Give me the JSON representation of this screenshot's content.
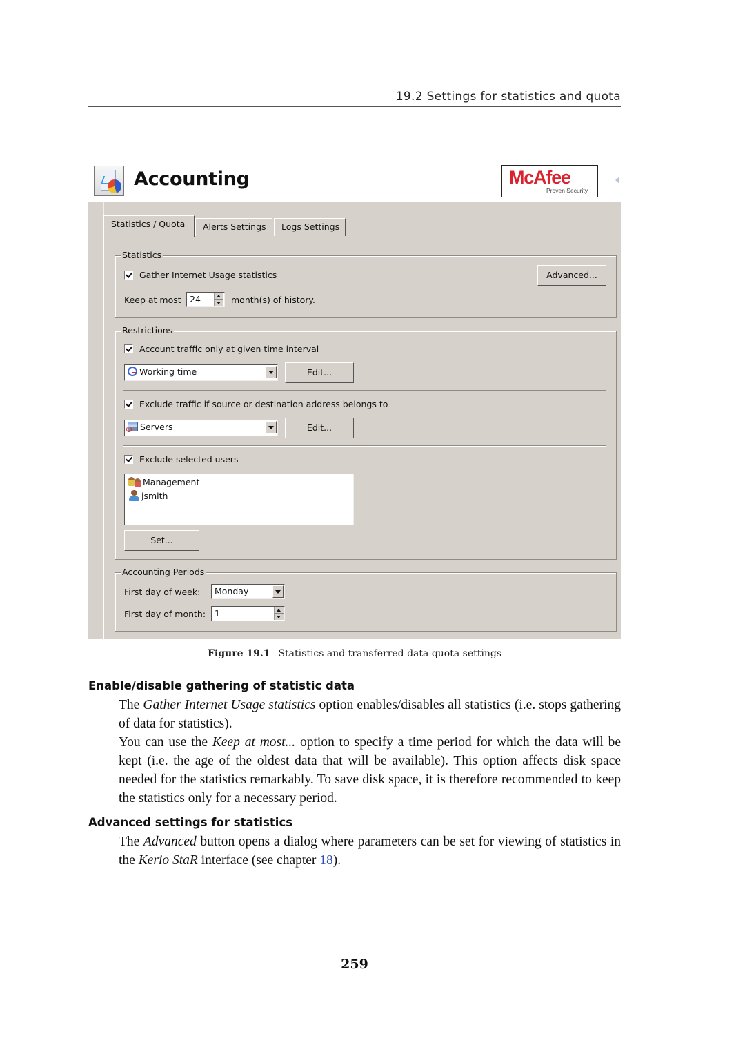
{
  "running_head": "19.2  Settings for statistics and quota",
  "figure": {
    "app_title": "Accounting",
    "logo": {
      "brand": "McAfee",
      "tagline": "Proven Security"
    },
    "tabs": [
      {
        "label": "Statistics / Quota",
        "active": true
      },
      {
        "label": "Alerts Settings",
        "active": false
      },
      {
        "label": "Logs Settings",
        "active": false
      }
    ],
    "statistics": {
      "legend": "Statistics",
      "gather_label": "Gather Internet Usage statistics",
      "gather_checked": true,
      "keep_label": "Keep at most",
      "keep_value": "24",
      "keep_suffix": "month(s) of history.",
      "advanced_button": "Advanced..."
    },
    "restrictions": {
      "legend": "Restrictions",
      "time_interval_label": "Account traffic only at given time interval",
      "time_interval_checked": true,
      "time_interval_value": "Working time",
      "time_interval_icon": "clock-icon",
      "edit_button_1": "Edit...",
      "exclude_address_label": "Exclude traffic if source or destination address belongs to",
      "exclude_address_checked": true,
      "address_group_value": "Servers",
      "address_group_icon": "server-group-icon",
      "edit_button_2": "Edit...",
      "exclude_users_label": "Exclude selected users",
      "exclude_users_checked": true,
      "users": [
        {
          "name": "Management",
          "icon": "user-group-icon"
        },
        {
          "name": "jsmith",
          "icon": "user-icon"
        }
      ],
      "set_button": "Set..."
    },
    "accounting_periods": {
      "legend": "Accounting Periods",
      "week_label": "First day of week:",
      "week_value": "Monday",
      "month_label": "First day of month:",
      "month_value": "1"
    },
    "caption_label": "Figure 19.1",
    "caption_text": "Statistics and transferred data quota settings"
  },
  "sections": [
    {
      "heading": "Enable/disable gathering of statistic data",
      "paragraphs": [
        {
          "p1_a": "The ",
          "p1_i": "Gather Internet Usage statistics",
          "p1_b": " option enables/disables all statistics (i.e. stops gathering of data for statistics)."
        },
        {
          "p2_a": "You can use the ",
          "p2_i": "Keep at most...",
          "p2_b": " option to specify a time period for which the data will be kept (i.e. the age of the oldest data that will be available). This option affects disk space needed for the statistics remarkably. To save disk space, it is therefore recommended to keep the statistics only for a necessary period."
        }
      ]
    },
    {
      "heading": "Advanced settings for statistics",
      "paragraphs": [
        {
          "p_a": "The ",
          "p_i1": "Advanced",
          "p_b": " button opens a dialog where parameters can be set for viewing of statistics in the ",
          "p_i2": "Kerio StaR",
          "p_c": " interface (see chapter ",
          "p_link": "18",
          "p_d": ")."
        }
      ]
    }
  ],
  "page_number": "259",
  "colors": {
    "dialog_background": "#d6d2cb",
    "brand_red": "#d9242f",
    "link_blue": "#2f4fb0"
  }
}
